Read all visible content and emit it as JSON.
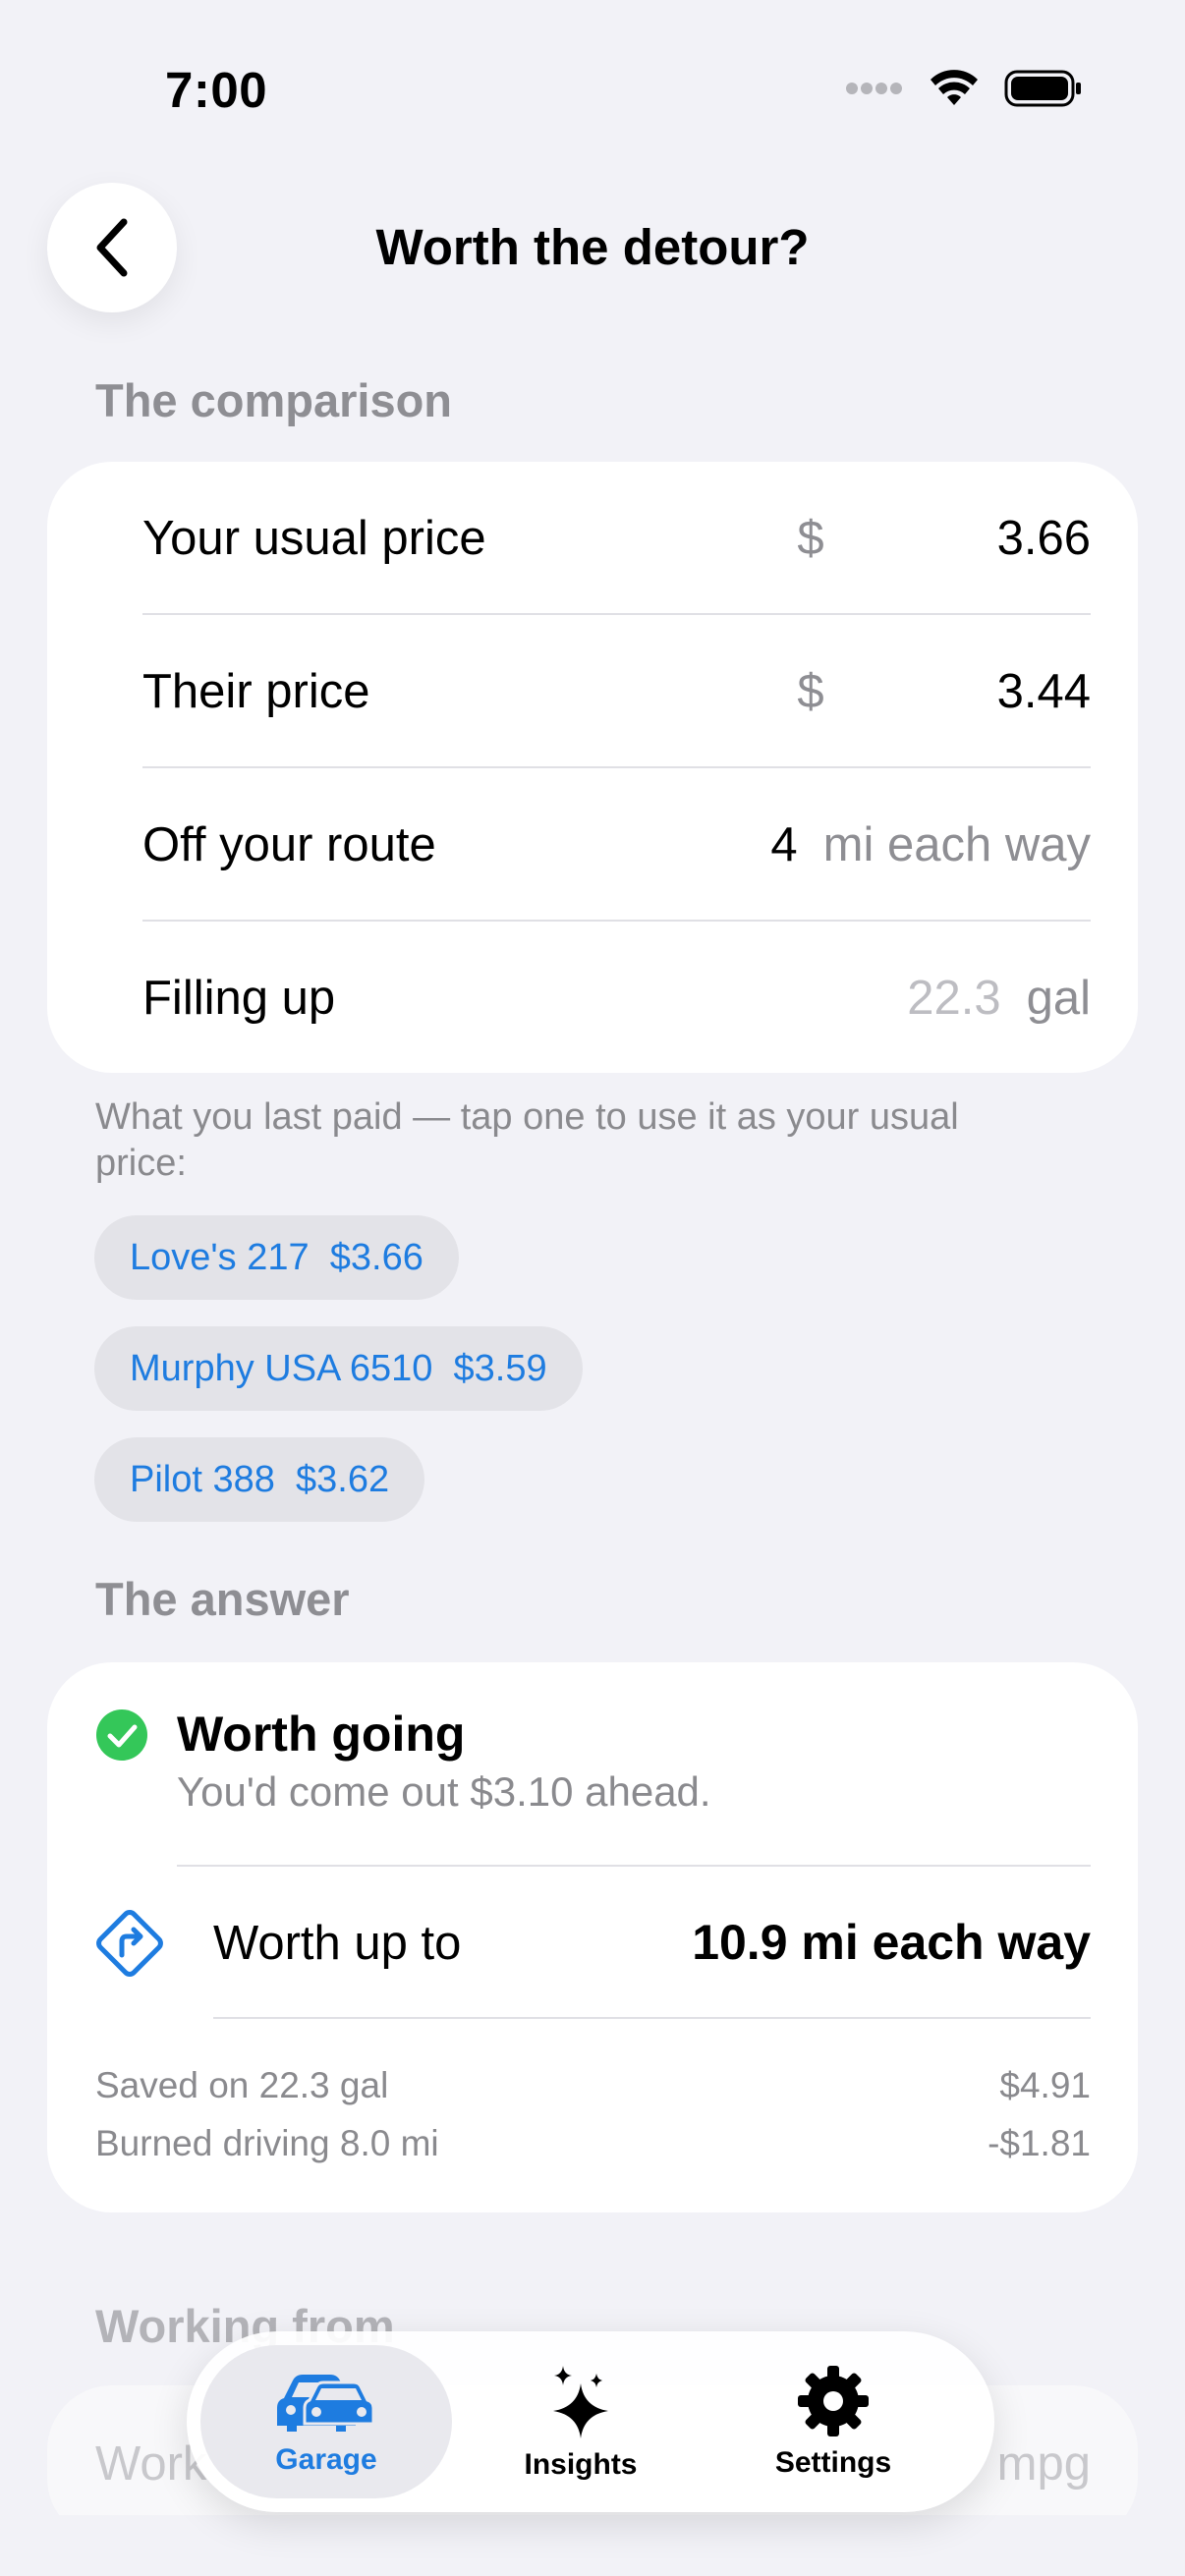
{
  "status_bar": {
    "time": "7:00"
  },
  "nav": {
    "title": "Worth the detour?"
  },
  "comparison": {
    "header": "The comparison",
    "usual_price": {
      "label": "Your usual price",
      "currency": "$",
      "value": "3.66"
    },
    "their_price": {
      "label": "Their price",
      "currency": "$",
      "value": "3.44"
    },
    "off_route": {
      "label": "Off your route",
      "value": "4",
      "unit": "mi each way"
    },
    "filling_up": {
      "label": "Filling up",
      "placeholder": "22.3",
      "unit": "gal"
    }
  },
  "last_paid": {
    "note": "What you last paid — tap one to use it as your usual price:",
    "chips": [
      {
        "station": "Love's 217",
        "price": "$3.66"
      },
      {
        "station": "Murphy USA 6510",
        "price": "$3.59"
      },
      {
        "station": "Pilot 388",
        "price": "$3.62"
      }
    ]
  },
  "answer": {
    "header": "The answer",
    "verdict_title": "Worth going",
    "verdict_detail": "You'd come out $3.10 ahead.",
    "worth_up_to_label": "Worth up to",
    "worth_up_to_value": "10.9 mi each way",
    "breakdown": [
      {
        "label": "Saved on 22.3 gal",
        "value": "$4.91"
      },
      {
        "label": "Burned driving 8.0 mi",
        "value": "-$1.81"
      }
    ]
  },
  "working_from": {
    "header": "Working from",
    "row_label": "Work",
    "row_unit": "mpg"
  },
  "tabbar": {
    "tabs": [
      {
        "label": "Garage",
        "icon": "car-icon",
        "active": true
      },
      {
        "label": "Insights",
        "icon": "sparkles-icon",
        "active": false
      },
      {
        "label": "Settings",
        "icon": "gear-icon",
        "active": false
      }
    ]
  },
  "colors": {
    "accent": "#1E7CE0",
    "success": "#34C759",
    "background": "#F2F2F7",
    "secondary_text": "#8E8E93"
  }
}
